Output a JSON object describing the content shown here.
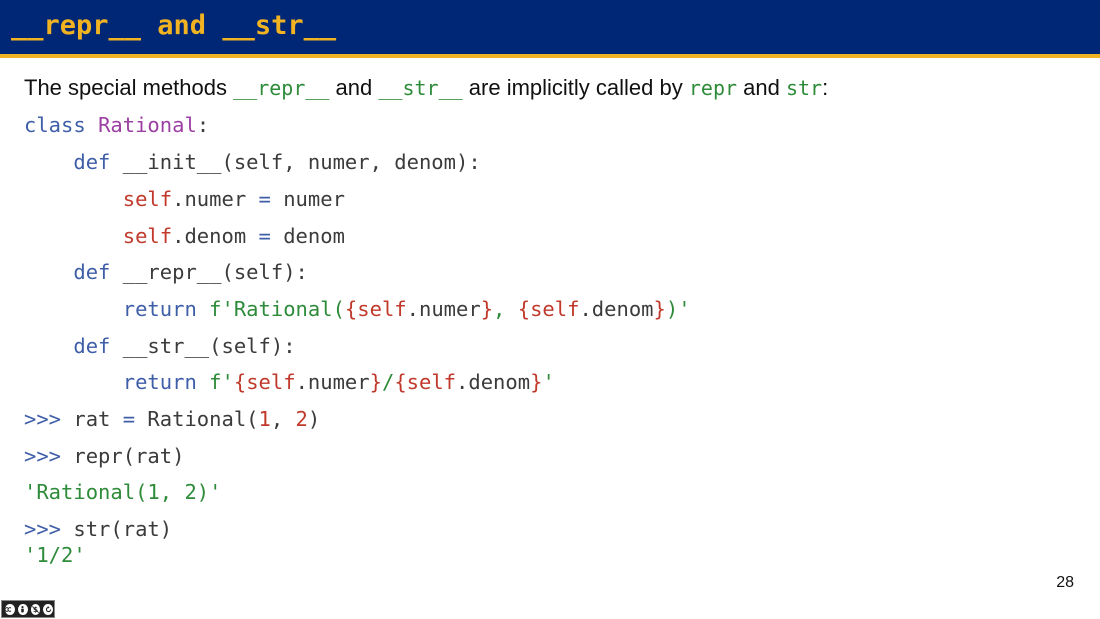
{
  "slide": {
    "title": "__repr__ and __str__",
    "page_number": "28"
  },
  "intro": {
    "t1": "The special methods ",
    "c1": "__repr__",
    "t2": " and ",
    "c2": "__str__",
    "t3": " are implicitly called by ",
    "c3": "repr",
    "t4": " and ",
    "c4": "str",
    "t5": ":"
  },
  "code": {
    "l1": {
      "kw": "class",
      "sp": " ",
      "name": "Rational",
      "rest": ":"
    },
    "l2": {
      "indent": "    ",
      "kw": "def",
      "rest": " __init__(self, numer, denom):"
    },
    "l3": {
      "indent": "        ",
      "self": "self",
      "mid": ".numer ",
      "op": "=",
      "rest": " numer"
    },
    "l4": {
      "indent": "        ",
      "self": "self",
      "mid": ".denom ",
      "op": "=",
      "rest": " denom"
    },
    "l5": {
      "indent": "    ",
      "kw": "def",
      "rest": " __repr__(self):"
    },
    "l6": {
      "indent": "        ",
      "kw": "return",
      "sp": " ",
      "s1": "f'Rational(",
      "b1": "{",
      "self1": "self",
      "a1": ".numer",
      "b2": "}",
      "s2": ", ",
      "b3": "{",
      "self2": "self",
      "a2": ".denom",
      "b4": "}",
      "s3": ")'"
    },
    "l7": {
      "indent": "    ",
      "kw": "def",
      "rest": " __str__(self):"
    },
    "l8": {
      "indent": "        ",
      "kw": "return",
      "sp": " ",
      "s1": "f'",
      "b1": "{",
      "self1": "self",
      "a1": ".numer",
      "b2": "}",
      "s2": "/",
      "b3": "{",
      "self2": "self",
      "a2": ".denom",
      "b4": "}",
      "s3": "'"
    },
    "l9": {
      "prompt": ">>>",
      "t1": " rat ",
      "op": "=",
      "t2": " Rational(",
      "n1": "1",
      "t3": ", ",
      "n2": "2",
      "t4": ")"
    },
    "l10": {
      "prompt": ">>>",
      "rest": " repr(rat)"
    },
    "l11": {
      "out": "'Rational(1, 2)'"
    },
    "l12": {
      "prompt": ">>>",
      "rest": " str(rat)"
    },
    "l13": {
      "out": "'1/2'"
    }
  },
  "license": {
    "icons": [
      "cc-icon",
      "by-icon",
      "nc-icon",
      "sa-icon"
    ]
  }
}
